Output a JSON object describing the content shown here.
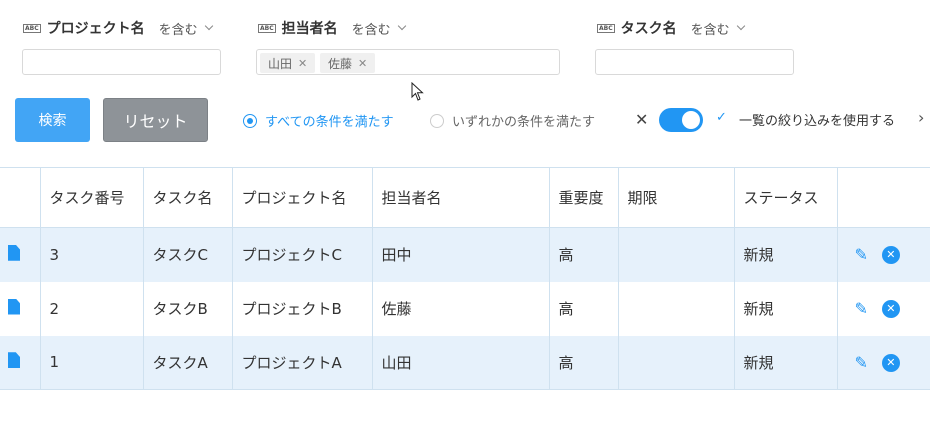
{
  "filters": [
    {
      "label": "プロジェクト名",
      "operator": "を含む",
      "tags": []
    },
    {
      "label": "担当者名",
      "operator": "を含む",
      "tags": [
        "山田",
        "佐藤"
      ]
    },
    {
      "label": "タスク名",
      "operator": "を含む",
      "tags": []
    }
  ],
  "buttons": {
    "search": "検索",
    "reset": "リセット"
  },
  "match": {
    "all": "すべての条件を満たす",
    "any": "いずれかの条件を満たす",
    "selected": "all"
  },
  "toggle": {
    "label": "一覧の絞り込みを使用する",
    "on": true
  },
  "table": {
    "columns": [
      "タスク番号",
      "タスク名",
      "プロジェクト名",
      "担当者名",
      "重要度",
      "期限",
      "ステータス"
    ],
    "rows": [
      {
        "no": "3",
        "task": "タスクC",
        "project": "プロジェクトC",
        "assignee": "田中",
        "priority": "高",
        "due": "",
        "status": "新規"
      },
      {
        "no": "2",
        "task": "タスクB",
        "project": "プロジェクトB",
        "assignee": "佐藤",
        "priority": "高",
        "due": "",
        "status": "新規"
      },
      {
        "no": "1",
        "task": "タスクA",
        "project": "プロジェクトA",
        "assignee": "山田",
        "priority": "高",
        "due": "",
        "status": "新規"
      }
    ]
  },
  "colors": {
    "accent": "#2196f3",
    "search_button": "#42a5f5",
    "reset_button": "#8e9398",
    "row_alt": "#e6f1fb"
  }
}
